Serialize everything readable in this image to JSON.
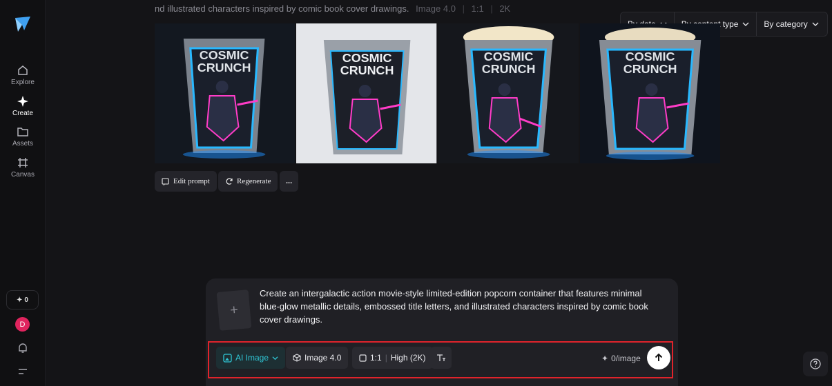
{
  "sidebar": {
    "items": [
      {
        "label": "Explore",
        "icon": "home-icon"
      },
      {
        "label": "Create",
        "icon": "sparkle-icon"
      },
      {
        "label": "Assets",
        "icon": "folder-icon"
      },
      {
        "label": "Canvas",
        "icon": "canvas-icon"
      }
    ],
    "credits": "0",
    "avatar_initial": "D"
  },
  "prompt_strip": {
    "text": "nd illustrated characters inspired by comic book cover drawings.",
    "model": "Image 4.0",
    "ratio": "1:1",
    "resolution": "2K"
  },
  "filters": [
    {
      "label": "By date"
    },
    {
      "label": "By content type"
    },
    {
      "label": "By category"
    }
  ],
  "images": {
    "caption_line1": "COSMIC",
    "caption_line2": "CRUNCH"
  },
  "actions": {
    "edit_prompt": "Edit prompt",
    "regenerate": "Regenerate",
    "more": "..."
  },
  "composer": {
    "upload_symbol": "+",
    "prompt": "Create an intergalactic action movie-style limited-edition popcorn container that features minimal blue-glow metallic details, embossed title letters, and illustrated characters inspired by comic book cover drawings.",
    "mode": "AI Image",
    "model": "Image 4.0",
    "ratio": "1:1",
    "quality": "High (2K)",
    "cost": "0/image"
  },
  "colors": {
    "accent": "#2fc7d6",
    "highlight_border": "#e0232b",
    "avatar": "#e0245e"
  }
}
